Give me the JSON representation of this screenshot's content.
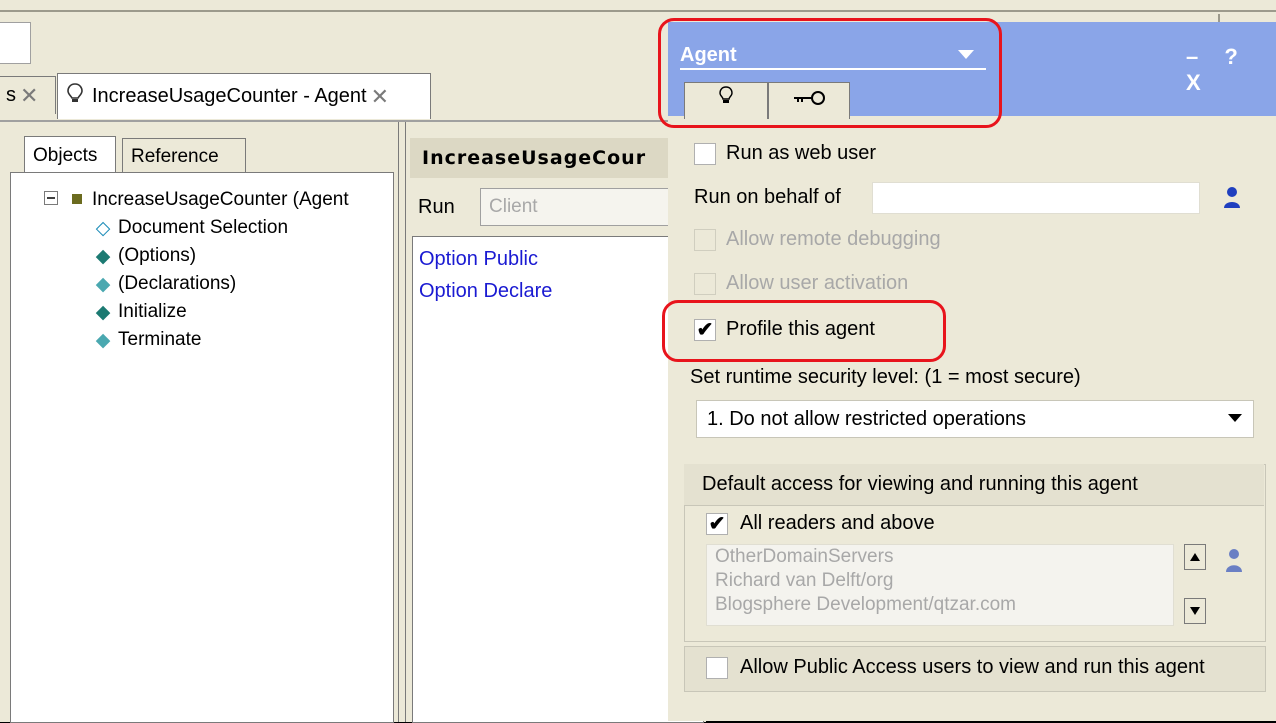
{
  "editor_tabs": [
    {
      "label": "s"
    },
    {
      "label": "IncreaseUsageCounter - Agent"
    }
  ],
  "left_panel": {
    "tabs": [
      "Objects",
      "Reference"
    ],
    "tree": {
      "root": "IncreaseUsageCounter (Agent",
      "items": [
        "Document Selection",
        "(Options)",
        "(Declarations)",
        "Initialize",
        "Terminate"
      ]
    }
  },
  "editor": {
    "title": "IncreaseUsageCour",
    "run_label": "Run",
    "run_value": "Client",
    "code_lines": [
      "Option Public",
      "Option Declare"
    ]
  },
  "properties": {
    "title": "Agent",
    "header_controls": "– ? X",
    "run_as_web_user": "Run as web user",
    "run_on_behalf_of": "Run on behalf of",
    "run_on_behalf_value": "",
    "allow_remote_debugging": "Allow remote debugging",
    "allow_user_activation": "Allow user activation",
    "profile_this_agent": "Profile this agent",
    "profile_checked": true,
    "security_level_label": "Set runtime security level: (1 = most secure)",
    "security_level_value": "1. Do not allow restricted operations",
    "default_access_heading": "Default access for viewing and running this agent",
    "all_readers_label": "All readers and above",
    "all_readers_checked": true,
    "readers": [
      "OtherDomainServers",
      "Richard van Delft/org",
      "Blogsphere Development/qtzar.com"
    ],
    "public_access_label": "Allow Public Access users to view and run this agent"
  },
  "colors": {
    "header_blue": "#8aa5e8",
    "highlight_red": "#e8141c",
    "code_blue": "#1a1ad2"
  }
}
